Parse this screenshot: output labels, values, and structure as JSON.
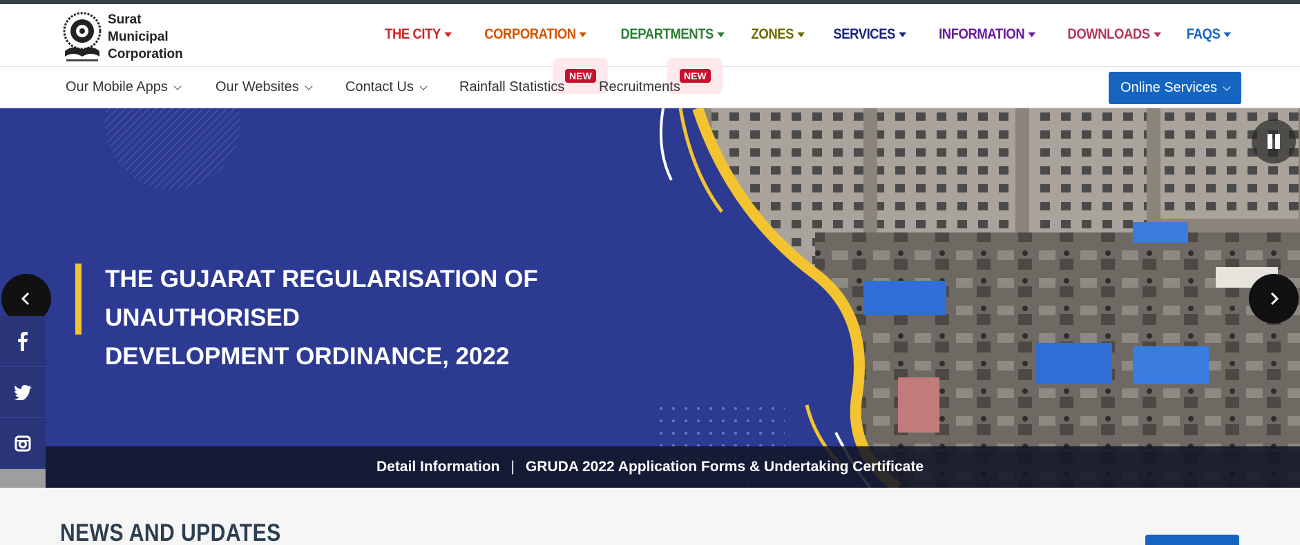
{
  "logo": {
    "name_line1": "Surat",
    "name_line2": "Municipal",
    "name_line3": "Corporation"
  },
  "main_nav": [
    {
      "label": "THE CITY",
      "color": "#c62828"
    },
    {
      "label": "CORPORATION",
      "color": "#d35400"
    },
    {
      "label": "DEPARTMENTS",
      "color": "#2e7d32"
    },
    {
      "label": "ZONES",
      "color": "#6b6b00"
    },
    {
      "label": "SERVICES",
      "color": "#1a237e"
    },
    {
      "label": "INFORMATION",
      "color": "#6a1b9a"
    },
    {
      "label": "DOWNLOADS",
      "color": "#b03a5b"
    },
    {
      "label": "FAQS",
      "color": "#1565c0"
    }
  ],
  "sub_nav": {
    "mobile_apps": "Our Mobile Apps",
    "websites": "Our Websites",
    "contact": "Contact Us",
    "rainfall": "Rainfall Statistics",
    "recruitments": "Recruitments",
    "new_badge": "NEW",
    "online_services": "Online Services"
  },
  "hero": {
    "title_line1": "THE GUJARAT REGULARISATION OF UNAUTHORISED",
    "title_line2": "DEVELOPMENT ORDINANCE, 2022",
    "link_detail": "Detail Information",
    "separator": "|",
    "link_forms": "GRUDA 2022 Application Forms & Undertaking Certificate"
  },
  "colors": {
    "hero_bg": "#2d3a92",
    "accent_yellow": "#f4c430",
    "primary_blue": "#1565c0"
  },
  "social_icons": [
    "facebook-icon",
    "twitter-icon",
    "instagram-icon",
    "youtube-icon"
  ],
  "news": {
    "title": "NEWS AND UPDATES"
  }
}
